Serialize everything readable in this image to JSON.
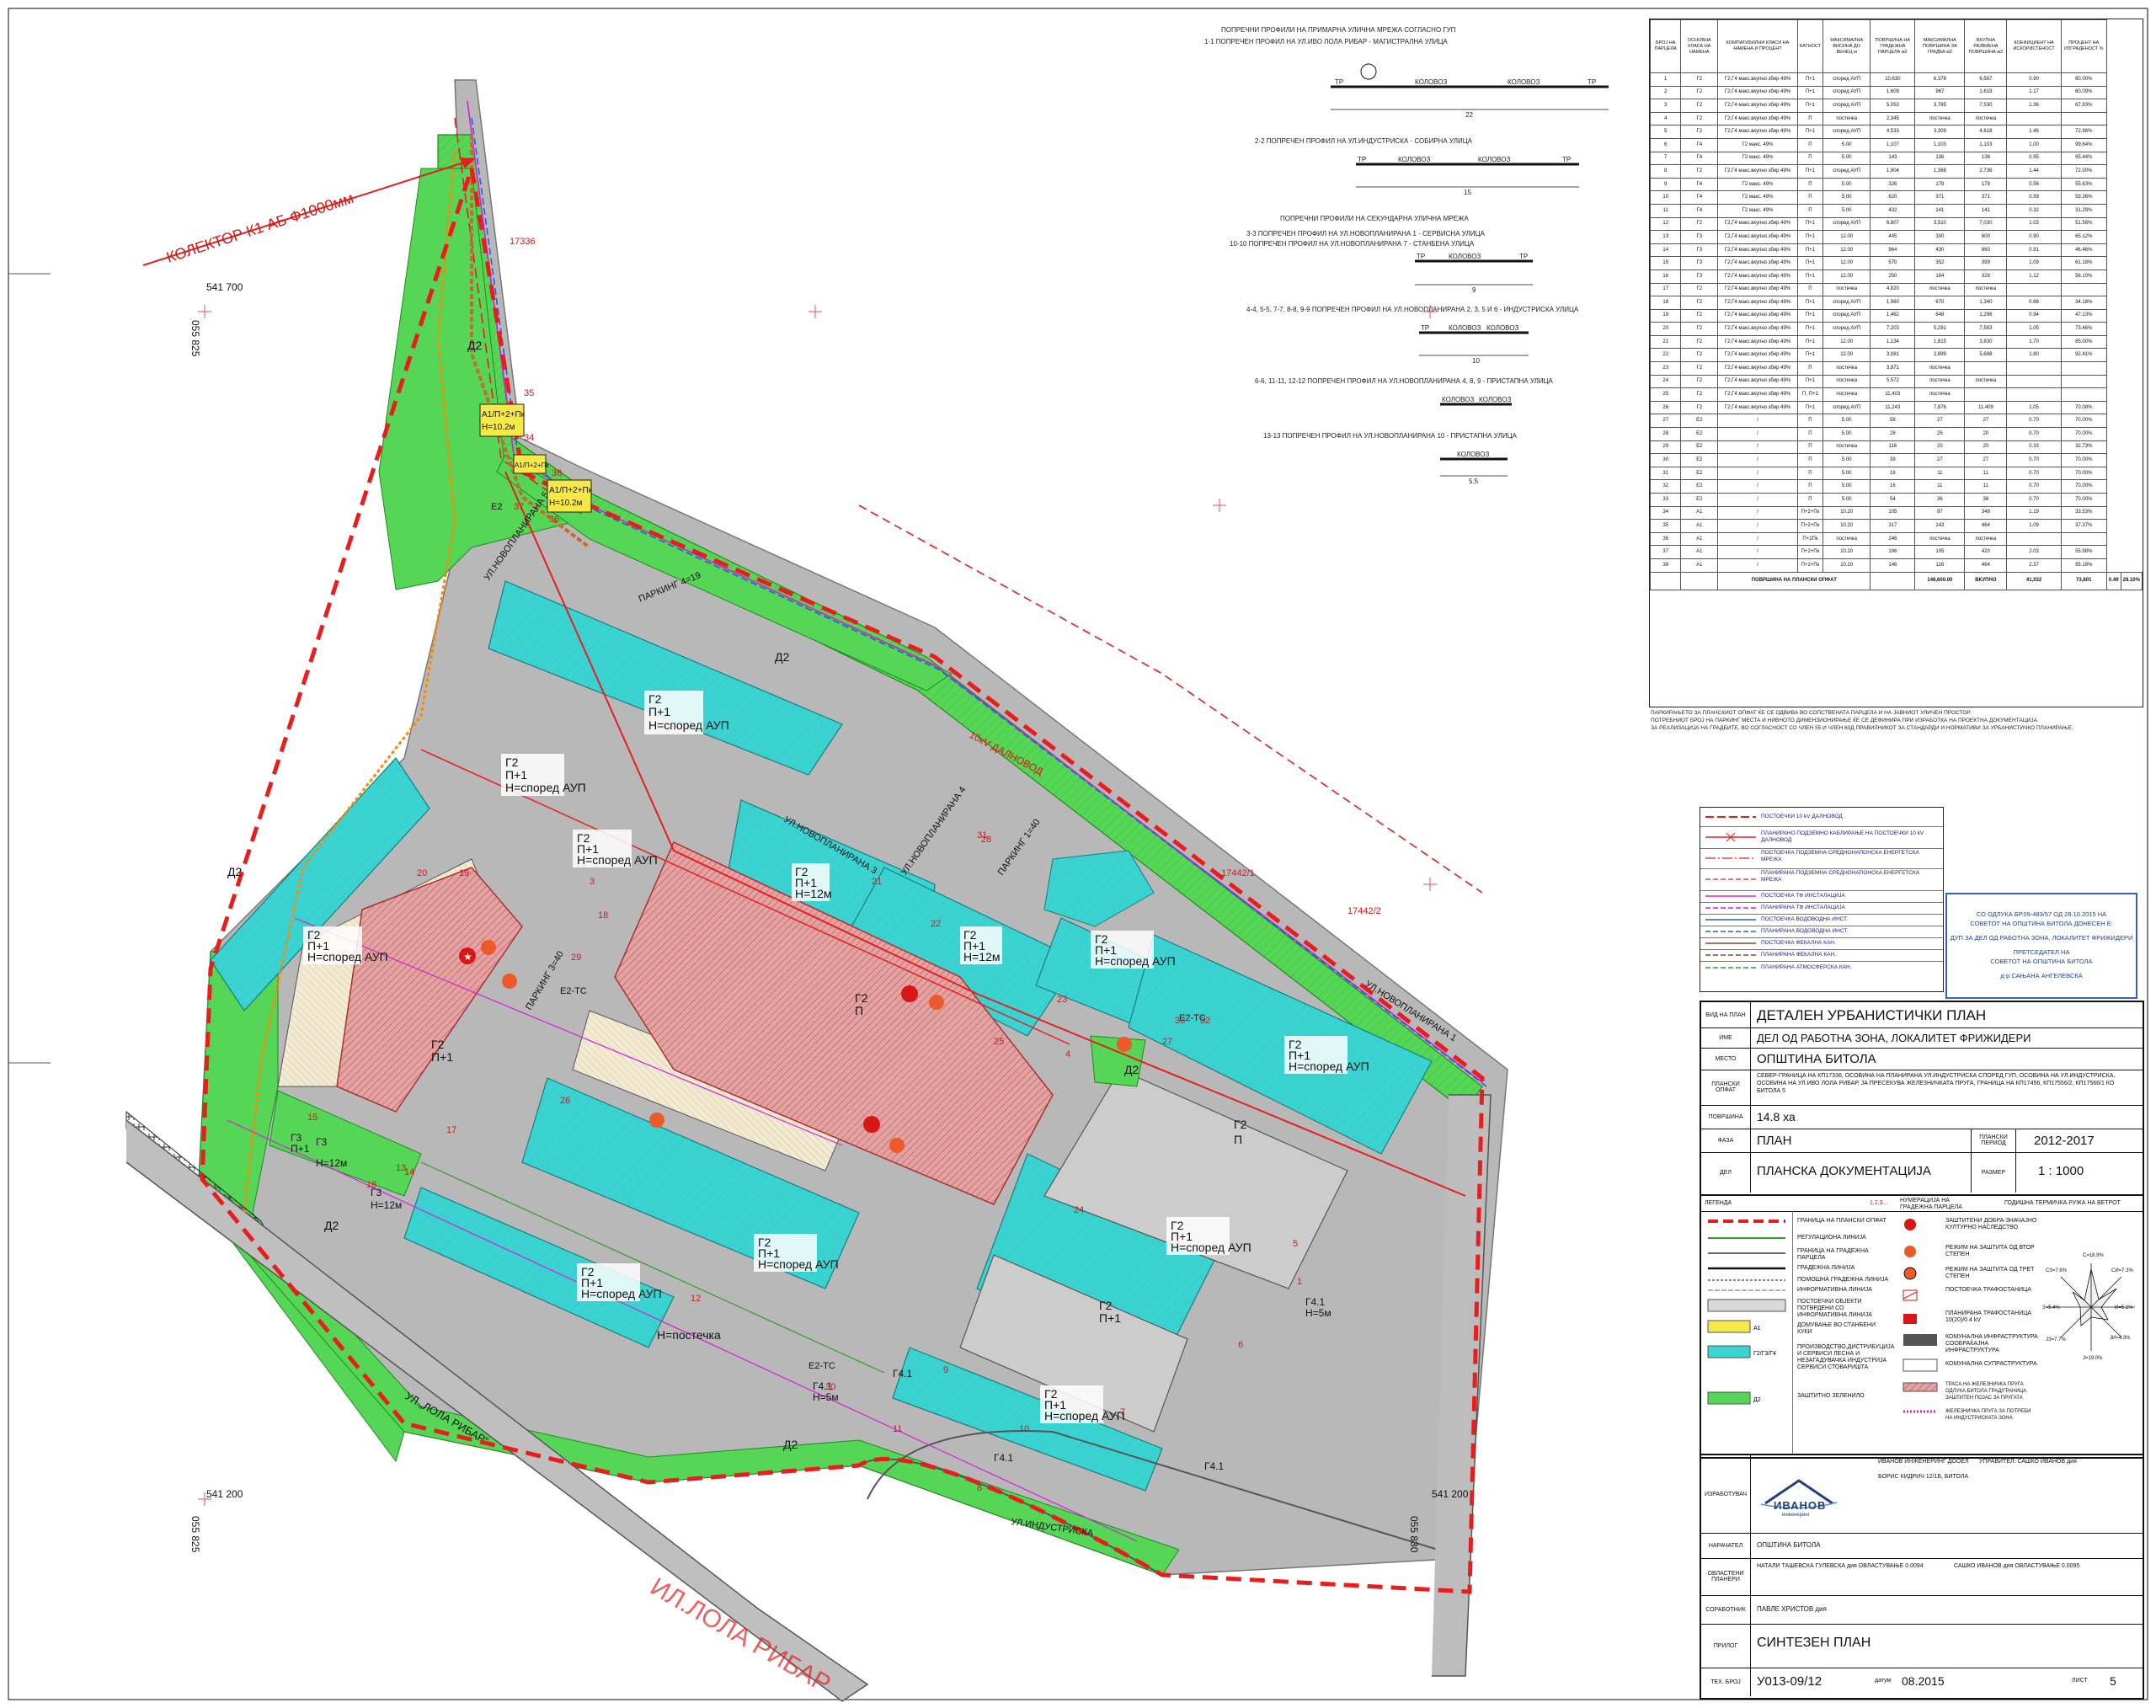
{
  "map": {
    "collector_label": "КОЛЕКТОР К1 АБ Ф1000мм",
    "coord_top_left": "541 700",
    "coord_bottom_left": "541 200",
    "coord_bottom_right": "541 200",
    "coord_vert_left": "055 825",
    "coord_vert_right": "055 830",
    "street_bottom": "УЛ.„ЛОЛА РИБАР“",
    "street_bottom_ghost": "ИЛ.ЛОЛА РИБАР",
    "parcel_refs": [
      "17336",
      "17442/1",
      "17442/2"
    ],
    "streets": [
      "УЛ.НОВОПЛАНИРАНА 1",
      "УЛ.НОВОПЛАНИРАНА 3",
      "УЛ.НОВОПЛАНИРАНА 4",
      "УЛ.НОВОПЛАНИРАНА 5",
      "УЛ.ИНДУСТРИСКА",
      "ПАРКИНГ 4=19",
      "ПАРКИНГ 3=40",
      "ПАРКИНГ 1=40"
    ],
    "zones": [
      {
        "code": "Д2"
      },
      {
        "code": "Г2",
        "floors": "П+1",
        "height": "Н=според АУП"
      },
      {
        "code": "Г2",
        "floors": "П+1",
        "height": "Н=12м"
      },
      {
        "code": "Г2",
        "floors": "П"
      },
      {
        "code": "А1",
        "floors": "П+2+Пк",
        "height": "Н=10.2м"
      },
      {
        "code": "Г3",
        "floors": "П+1",
        "height": "Н=12м"
      },
      {
        "code": "Г4.1",
        "floors": "П",
        "height": "Н=5м"
      },
      {
        "code": "Е2"
      },
      {
        "code": "Е2-ТС"
      }
    ],
    "labels": {
      "d2": "Д2",
      "g2": "Г2",
      "p1": "П+1",
      "p": "П",
      "h_aup": "Н=според АУП",
      "h12": "Н=12м",
      "h_post": "Н=постечка",
      "a1": "А1/П+2+Пк",
      "a1h": "Н=10.2м",
      "g3": "Г3",
      "g41": "Г4.1",
      "h5": "Н=5м",
      "e2": "Е2",
      "e2tc": "Е2-ТС",
      "kolovoz": "КОЛОВОЗ",
      "street_1": "УЛ.НОВОПЛАНИРАНА 1",
      "street_3": "УЛ.НОВОПЛАНИРАНА 3",
      "street_4": "УЛ.НОВОПЛАНИРАНА 4",
      "street_5": "УЛ.НОВОПЛАНИРАНА 5",
      "street_ind": "УЛ.ИНДУСТРИСКА",
      "parking_19": "ПАРКИНГ 4=19",
      "parking_40a": "ПАРКИНГ 3=40",
      "parking_40b": "ПАРКИНГ 1=40",
      "kv10": "10кV ДАЛНОВОД"
    },
    "parcel_numbers": [
      "1",
      "2",
      "3",
      "4",
      "5",
      "6",
      "7",
      "8",
      "9",
      "10",
      "11",
      "12",
      "13",
      "14",
      "15",
      "16",
      "17",
      "18",
      "19",
      "20",
      "21",
      "22",
      "23",
      "24",
      "25",
      "26",
      "27",
      "28",
      "29",
      "30",
      "31",
      "32",
      "33",
      "34",
      "35",
      "36",
      "37",
      "38"
    ]
  },
  "profiles": {
    "heading_primary": "ПОПРЕЧНИ ПРОФИЛИ НА ПРИМАРНА УЛИЧНА МРЕЖА СОГЛАСНО ГУП",
    "p1": "1-1 ПОПРЕЧЕН ПРОФИЛ НА УЛ.ИВО ЛОЛА РИБАР - МАГИСТРАЛНА УЛИЦА",
    "p2": "2-2 ПОПРЕЧЕН ПРОФИЛ НА УЛ.ИНДУСТРИСКА - СОБИРНА УЛИЦА",
    "heading_secondary": "ПОПРЕЧНИ ПРОФИЛИ НА СЕКУНДАРНА УЛИЧНА МРЕЖА",
    "p3": "3-3 ПОПРЕЧЕН ПРОФИЛ НА УЛ.НОВОПЛАНИРАНА 1 - СЕРВИСНА УЛИЦА",
    "p3b": "10-10 ПОПРЕЧЕН ПРОФИЛ НА УЛ.НОВОПЛАНИРАНА 7 - СТАНБЕНА УЛИЦА",
    "p4": "4-4, 5-5, 7-7, 8-8, 9-9 ПОПРЕЧЕН ПРОФИЛ НА УЛ.НОВОПЛАНИРАНА 2, 3, 5 И 6 - ИНДУСТРИСКА УЛИЦА",
    "p6": "6-6, 11-11, 12-12 ПОПРЕЧЕН ПРОФИЛ НА УЛ.НОВОПЛАНИРАНА 4, 8, 9 - ПРИСТАПНА УЛИЦА",
    "p13": "13-13 ПОПРЕЧЕН ПРОФИЛ НА УЛ.НОВОПЛАНИРАНА 10 - ПРИСТАПНА УЛИЦА",
    "kolovoz": "КОЛОВОЗ",
    "tr": "ТР",
    "dims": {
      "p1": "22",
      "p2": "15",
      "p3": "9",
      "p4": "10",
      "p13": "5.5"
    }
  },
  "balance_table": {
    "headers": [
      "БРОЈ НА ПАРЦЕЛА",
      "ОСНОВНА КЛАСА НА НАМЕНА",
      "КОМПАТИБИЛНИ КЛАСИ НА НАМЕНА И ПРОЦЕНТ",
      "КАТНОСТ",
      "МАКСИМАЛНА ВИСИНА ДО ВЕНЕЦ м",
      "ПОВРШИНА НА ГРАДЕЖНА ПАРЦЕЛА м2",
      "МАКСИМАЛНА ПОВРШИНА ЗА ГРАДБА м2",
      "ВКУПНА РАЗВИЕНА ПОВРШИНА м2",
      "КОЕФИЦИЕНТ НА ИСКОРИСТЕНОСТ",
      "ПРОЦЕНТ НА ИЗГРАДЕНОСТ %"
    ],
    "rows": [
      [
        "1",
        "Г2",
        "Г2,Г4 макс.вкупно збир 49%",
        "П+1",
        "според АУП",
        "10,630",
        "6,378",
        "6,567",
        "0.90",
        "60.00%"
      ],
      [
        "2",
        "Г2",
        "Г2,Г4 макс.вкупно збир 49%",
        "П+1",
        "според АУП",
        "1,609",
        "967",
        "1,619",
        "1.17",
        "60.09%"
      ],
      [
        "3",
        "Г2",
        "Г2,Г4 макс.вкупно збир 49%",
        "П+1",
        "според АУП",
        "5,053",
        "3,765",
        "7,530",
        "1.36",
        "67.93%"
      ],
      [
        "4",
        "Г2",
        "Г2,Г4 макс.вкупно збир 49%",
        "П",
        "постечка",
        "2,345",
        "постечка",
        "постечка",
        "",
        ""
      ],
      [
        "5",
        "Г2",
        "Г2,Г4 макс.вкупно збир 49%",
        "П+1",
        "според АУП",
        "4,533",
        "3,309",
        "4,618",
        "1.46",
        "72.98%"
      ],
      [
        "6",
        "Г4",
        "Г2 макс. 49%",
        "П",
        "5.00",
        "1,107",
        "1,103",
        "1,103",
        "1.00",
        "99.64%"
      ],
      [
        "7",
        "Г4",
        "Г2 макс. 49%",
        "П",
        "5.00",
        "143",
        "136",
        "136",
        "0.95",
        "95.44%"
      ],
      [
        "8",
        "Г2",
        "Г2,Г4 макс.вкупно збир 49%",
        "П+1",
        "според АУП",
        "1,904",
        "1,368",
        "2,736",
        "1.44",
        "72.00%"
      ],
      [
        "9",
        "Г4",
        "Г2 макс. 49%",
        "П",
        "5.00",
        "326",
        "178",
        "178",
        "0.56",
        "55.63%"
      ],
      [
        "10",
        "Г4",
        "Г2 макс. 49%",
        "П",
        "5.00",
        "620",
        "371",
        "371",
        "0.59",
        "59.36%"
      ],
      [
        "11",
        "Г4",
        "Г2 макс. 49%",
        "П",
        "5.00",
        "432",
        "141",
        "141",
        "0.32",
        "31.29%"
      ],
      [
        "12",
        "Г2",
        "Г2,Г4 макс.вкупно збир 49%",
        "П+1",
        "според АУП",
        "6,807",
        "3,510",
        "7,030",
        "1.03",
        "51.56%"
      ],
      [
        "13",
        "Г3",
        "Г2,Г4 макс.вкупно збир 49%",
        "П+1",
        "12.00",
        "445",
        "300",
        "600",
        "0.90",
        "65.12%"
      ],
      [
        "14",
        "Г3",
        "Г2,Г4 макс.вкупно збир 49%",
        "П+1",
        "12.00",
        "964",
        "430",
        "860",
        "0.91",
        "46.46%"
      ],
      [
        "15",
        "Г3",
        "Г2,Г4 макс.вкупно збир 49%",
        "П+1",
        "12.00",
        "570",
        "352",
        "399",
        "1.09",
        "61.18%"
      ],
      [
        "16",
        "Г3",
        "Г2,Г4 макс.вкупно збир 49%",
        "П+1",
        "12.00",
        "250",
        "164",
        "328",
        "1.12",
        "56.10%"
      ],
      [
        "17",
        "Г2",
        "Г2,Г4 макс.вкупно збир 49%",
        "П",
        "постечка",
        "4,820",
        "постечка",
        "постечка",
        "",
        ""
      ],
      [
        "18",
        "Г2",
        "Г2,Г4 макс.вкупно збир 49%",
        "П+1",
        "според АУП",
        "1,960",
        "670",
        "1,340",
        "0.68",
        "34.18%"
      ],
      [
        "19",
        "Г2",
        "Г2,Г4 макс.вкупно збир 49%",
        "П+1",
        "според АУП",
        "1,462",
        "648",
        "1,296",
        "0.94",
        "47.13%"
      ],
      [
        "20",
        "Г2",
        "Г2,Г4 макс.вкупно збир 49%",
        "П+1",
        "според АУП",
        "7,203",
        "5,291",
        "7,583",
        "1.05",
        "73.46%"
      ],
      [
        "21",
        "Г2",
        "Г2,Г4 макс.вкупно збир 49%",
        "П+1",
        "12.00",
        "1,134",
        "1,815",
        "3,630",
        "1.70",
        "85.00%"
      ],
      [
        "22",
        "Г2",
        "Г2,Г4 макс.вкупно збир 49%",
        "П+1",
        "12.00",
        "3,081",
        "2,899",
        "5,698",
        "1.80",
        "92.41%"
      ],
      [
        "23",
        "Г2",
        "Г2,Г4 макс.вкупно збир 49%",
        "П",
        "постечка",
        "3,871",
        "постечка",
        "",
        "",
        ""
      ],
      [
        "24",
        "Г2",
        "Г2,Г4 макс.вкупно збир 49%",
        "П+1",
        "постечка",
        "5,572",
        "постечка",
        "постечка",
        "",
        ""
      ],
      [
        "25",
        "Г2",
        "Г2,Г4 макс.вкупно збир 49%",
        "П, П+1",
        "постечка",
        "11,403",
        "постечка",
        "",
        "",
        ""
      ],
      [
        "26",
        "Г2",
        "Г2,Г4 макс.вкупно збир 49%",
        "П+1",
        "според АУП",
        "11,243",
        "7,876",
        "11,409",
        "1.05",
        "70.08%"
      ],
      [
        "27",
        "Е2",
        "/",
        "П",
        "5.00",
        "58",
        "27",
        "27",
        "0.70",
        "70.00%"
      ],
      [
        "28",
        "Е2",
        "/",
        "П",
        "5.00",
        "28",
        "25",
        "20",
        "0.70",
        "70.00%"
      ],
      [
        "29",
        "Е2",
        "/",
        "П",
        "постечка",
        "116",
        "20",
        "20",
        "0.33",
        "32.73%"
      ],
      [
        "30",
        "Е2",
        "/",
        "П",
        "5.00",
        "39",
        "27",
        "27",
        "0.70",
        "70.00%"
      ],
      [
        "31",
        "Е2",
        "/",
        "П",
        "5.00",
        "16",
        "11",
        "11",
        "0.70",
        "70.00%"
      ],
      [
        "32",
        "Е2",
        "/",
        "П",
        "5.00",
        "16",
        "11",
        "11",
        "0.70",
        "70.00%"
      ],
      [
        "33",
        "Е2",
        "/",
        "П",
        "5.00",
        "54",
        "36",
        "38",
        "0.70",
        "70.00%"
      ],
      [
        "34",
        "А1",
        "/",
        "П+2+Пк",
        "10.20",
        "105",
        "97",
        "348",
        "1.19",
        "33.53%"
      ],
      [
        "35",
        "А1",
        "/",
        "П+2+Пк",
        "10.20",
        "317",
        "143",
        "464",
        "1.09",
        "37.37%"
      ],
      [
        "36",
        "А1",
        "/",
        "П+2Пк",
        "постечка",
        "246",
        "постечка",
        "постечка",
        "",
        ""
      ],
      [
        "37",
        "А1",
        "/",
        "П+2+Пк",
        "10.20",
        "196",
        "105",
        "420",
        "2.03",
        "55.98%"
      ],
      [
        "38",
        "А1",
        "/",
        "П+2+Пк",
        "10.20",
        "146",
        "116",
        "464",
        "2.37",
        "95.18%"
      ]
    ],
    "total": [
      "",
      "",
      "ПОВРШИНА НА ПЛАНСКИ ОПФАТ",
      "",
      "",
      "148,600.00",
      "ВКУПНО",
      "41,032",
      "73,801",
      "0.49",
      "28.10%"
    ]
  },
  "notes": [
    "ПАРКИРАЊЕТО ЗА ПЛАНСКИОТ ОПФАТ ЌЕ СЕ ОДВИВА ВО СОПСТВЕНАТА ПАРЦЕЛА И НА ЈАВНИОТ УЛИЧЕН ПРОСТОР.",
    "ПОТРЕБНИОТ БРОЈ НА ПАРКИНГ МЕСТА И НИВНОТО ДИМЕНЗИОНИРАЊЕ ЌЕ СЕ ДЕФИНИРА ПРИ ИЗРАБОТКА НА ПРОЕКТНА ДОКУМЕНТАЦИЈА.",
    "ЗА РЕАЛИЗАЦИЈА НА ГРАДБИТЕ, ВО СОГЛАСНОСТ СО ЧЛЕН 55 И ЧЛЕН 60Д ПРАВИЛНИКОТ ЗА СТАНДАРДИ И НОРМАТИВИ ЗА УРБАНИСТИЧКО ПЛАНИРАЊЕ."
  ],
  "line_legend": [
    "ПОСТОЕЧКИ 10 kV ДАЛНОВОД",
    "ПЛАНИРАНО ПОДЗЕМНО КАБЛИРАЊЕ НА ПОСТОЕЧКИ 10 kV ДАЛНОВОД",
    "ПОСТОЕЧКА ПОДЗЕМНА СРЕДНОНАПОНСКА ЕНЕРГЕТСКА МРЕЖА",
    "ПЛАНИРАНА ПОДЗЕМНА СРЕДНОНАПОНСКА ЕНЕРГЕТСКА МРЕЖА",
    "ПОСТОЕЧКА ТФ ИНСТАЛАЦИЈА",
    "ПЛАНИРАНА ТФ ИНСТАЛАЦИЈА",
    "ПОСТОЕЧКА ВОДОВОДНА ИНСТ.",
    "ПЛАНИРАНА ВОДОВОДНА ИНСТ.",
    "ПОСТОЕЧКА ФЕКАЛНА КАН.",
    "ПЛАНИРАНА ФЕКАЛНА КАН.",
    "ПЛАНИРАНА АТМОСФЕРСКА КАН."
  ],
  "council": {
    "l1": "СО ОДЛУКА БР.09-483/57 ОД 28.10.2015 НА",
    "l2": "СОВЕТОТ НА ОПШТИНА БИТОЛА ДОНЕСЕН Е:",
    "l3": "ДУП ЗА ДЕЛ ОД РАБОТНА ЗОНА, ЛОКАЛИТЕТ ФРИЖИДЕРИ",
    "l4": "ПРЕТСЕДАТЕЛ НА",
    "l5": "СОВЕТОТ НА ОПШТИНА БИТОЛА",
    "l6": "д-р САЊАНА АНГЕЛЕВСКА"
  },
  "title_block": {
    "k_type": "ВИД НА ПЛАН",
    "type": "ДЕТАЛЕН УРБАНИСТИЧКИ ПЛАН",
    "k_name": "ИМЕ",
    "name": "ДЕЛ ОД РАБОТНА ЗОНА, ЛОКАЛИТЕТ ФРИЖИДЕРИ",
    "k_place": "МЕСТО",
    "place": "ОПШТИНА БИТОЛА",
    "k_scope": "ПЛАНСКИ ОПФАТ",
    "scope": "СЕВЕР-ГРАНИЦА НА КП17336, ОСОВИНА НА ПЛАНИРАНА УЛ.ИНДУСТРИСКА СПОРЕД ГУП, ОСОВИНА НА УЛ.ИНДУСТРИСКА, ОСОВИНА НА УЛ.ИВО ЛОЛА РИБАР, ЈА ПРЕСЕКУВА ЖЕЛЕЗНИЧКАТА ПРУГА, ГРАНИЦА НА КП17456, КП17556/2, КП17566/1 КО БИТОЛА 5",
    "k_area": "ПОВРШИНА",
    "area": "14.8 ха",
    "k_phase": "ФАЗА",
    "phase": "ПЛАН",
    "k_period": "ПЛАНСКИ ПЕРИОД",
    "period": "2012-2017",
    "k_part": "ДЕЛ",
    "part": "ПЛАНСКА ДОКУМЕНТАЦИЈА",
    "k_scale": "РАЗМЕР",
    "scale": "1 : 1000"
  },
  "legend": {
    "title": "ЛЕГЕНДА",
    "numbering": "НУМЕРАЦИЈА НА ГРАДЕЖНА ПАРЦЕЛА",
    "numbering_sample": "1,2,3...",
    "wind": "ГОДИШНА ТЕРМИЧКА РУЖА НА ВЕТРОТ",
    "items_left": [
      "ГРАНИЦА НА ПЛАНСКИ ОПФАТ",
      "РЕГУЛАЦИОНА ЛИНИЈА",
      "ГРАНИЦА НА ГРАДЕЖНА ПАРЦЕЛА",
      "ГРАДЕЖНА ЛИНИЈА",
      "ПОМОШНА ГРАДЕЖНА ЛИНИЈА",
      "ИНФОРМАТИВНА ЛИНИЈА",
      "ПОСТОЕЧКИ ОБЈЕКТИ ПОТВРДЕНИ СО ИНФОРМАТИВНА ЛИНИЈА",
      "ДОМУВАЊЕ ВО СТАНБЕНИ КУЌИ",
      "ПРОИЗВОДСТВО,ДИСТРИБУЦИЈА И СЕРВИСИ ЛЕСНА И НЕЗАГАДУВАЧКА ИНДУСТРИЈА СЕРВИСИ СТОВАРИШТА",
      "ЗАШТИТНО ЗЕЛЕНИЛО"
    ],
    "items_right": [
      "ЗАШТИТЕНИ ДОБРА-ЗНАЧАЈНО КУЛТУРНО НАСЛЕДСТВО",
      "РЕЖИМ НА ЗАШТИТА ОД ВТОР СТЕПЕН",
      "РЕЖИМ НА ЗАШТИТА ОД ТРЕТ СТЕПЕН",
      "ПОСТОЕЧКА ТРАФОСТАНИЦА",
      "ПЛАНИРАНА ТРАФОСТАНИЦА 10(20)/0.4 kV",
      "КОМУНАЛНА ИНФРАСТРУКТУРА СООБРАЌАЈНА ИНФРАСТРУКТУРА",
      "КОМУНАЛНА СУПРАСТРУКТУРА",
      "ТРАСА НА ЖЕЛЕЗНИЧКА ПРУГА ОДЛУКА БИТОЛА ГРАД/ГРАНИЦА ЗАШТИТЕН ПОЈАС ЗА ПРУГАТА",
      "ЖЕЛЕЗНИЧКА ПРУГА ЗА ПОТРЕБИ НА ИНДУСТРИСКАТА ЗОНА"
    ],
    "codes": [
      "А1",
      "Г2/Г3/Г4",
      "Д2",
      "Е1",
      "Е2"
    ],
    "wind_labels": [
      "С=18.9%",
      "СИ=7.3%",
      "И=5.1%",
      "ЈИ=4.3%",
      "Ј=19.0%",
      "ЈЗ=7.7%",
      "З=5.4%",
      "СЗ=7.6%"
    ]
  },
  "bottom_block": {
    "k_made": "ИЗРАБОТУВАЧ",
    "company": "ИВАНОВ ИНЖЕНЕРИНГ ДООЕЛ",
    "address": "БОРИС КИДРИЧ 12/1Б, БИТОЛА",
    "manager": "УПРАВИТЕЛ: САШКО ИВАНОВ дия",
    "logo": "ИВАНОВ",
    "logo_sub": "инженеринг",
    "k_client": "НАРАЧАТЕЛ",
    "client": "ОПШТИНА БИТОЛА",
    "k_planners": "ОВЛАСТЕНИ ПЛАНЕРИ",
    "planner1": "НАТАЛИ ТАШЕВСКА ГУЛЕВСКА дия ОВЛАСТУВАЊЕ 0.0094",
    "planner2": "САШКО ИВАНОВ дия ОВЛАСТУВАЊЕ 0.0095",
    "k_assoc": "СОРАБОТНИК",
    "assoc": "ПАВЛЕ ХРИСТОВ дия",
    "k_annex": "ПРИЛОГ",
    "annex": "СИНТЕЗЕН ПЛАН",
    "k_tech": "ТЕХ. БРОЈ",
    "tech": "У013-09/12",
    "k_date": "датум",
    "date": "08.2015",
    "k_sheet": "ЛИСТ",
    "sheet": "5"
  }
}
